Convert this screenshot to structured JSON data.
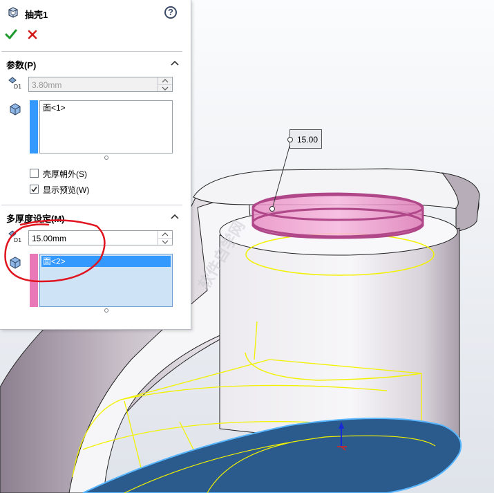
{
  "feature": {
    "title": "抽壳1",
    "help_icon": "help-icon"
  },
  "actions": {
    "ok_icon": "check-icon",
    "cancel_icon": "close-icon"
  },
  "parameters": {
    "section_title": "参数(P)",
    "thickness_value": "3.80mm",
    "faces_list": [
      "面<1>"
    ],
    "shell_outward_label": "壳厚朝外(S)",
    "shell_outward_checked": false,
    "show_preview_label": "显示预览(W)",
    "show_preview_checked": true
  },
  "multi_thickness": {
    "section_title": "多厚度设定(M)",
    "thickness_value": "15.00mm",
    "faces_list": [
      "面<2>"
    ]
  },
  "viewport": {
    "dimension_callout": "15.00"
  },
  "colors": {
    "accent_blue": "#3399ff",
    "face_pink": "#e66bb0",
    "bottom_face": "#2b5b8c",
    "edge_yellow": "#f2f200",
    "annotation_red": "#e0141e"
  }
}
